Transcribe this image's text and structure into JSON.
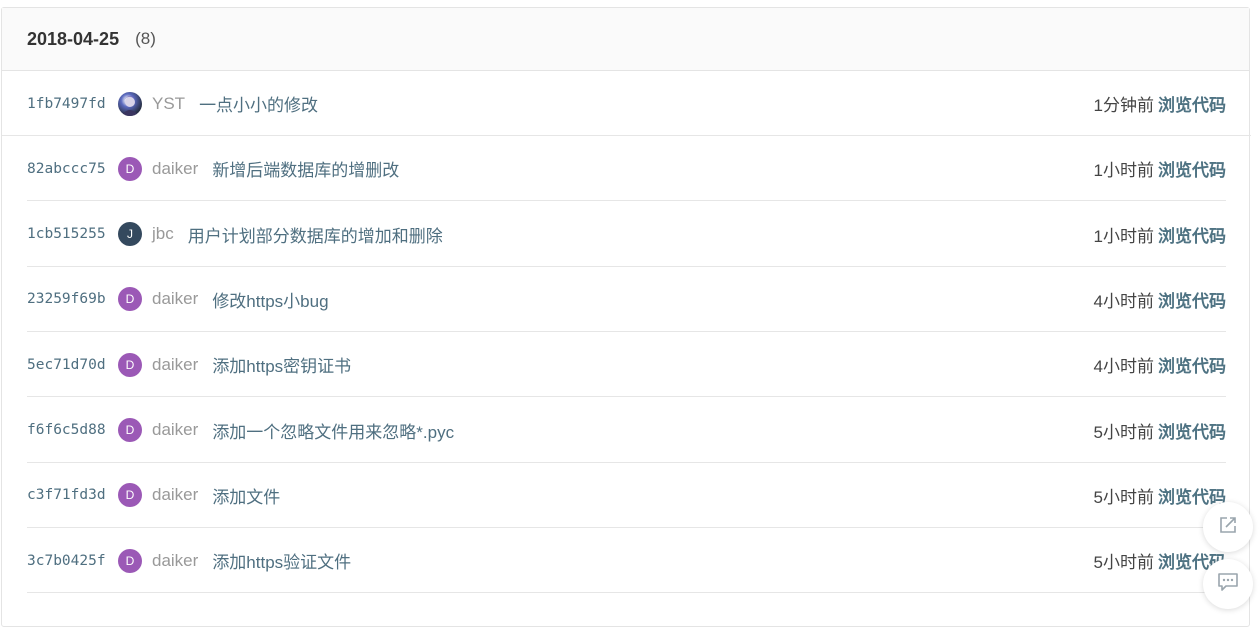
{
  "group": {
    "date": "2018-04-25",
    "count": "(8)"
  },
  "browse_label": "浏览代码",
  "commits": [
    {
      "sha": "1fb7497fd",
      "avatar": "",
      "avatar_type": "photo",
      "avatar_color": "#4a3f7a",
      "author": "YST",
      "message": "一点小小的修改",
      "time": "1分钟前"
    },
    {
      "sha": "82abccc75",
      "avatar": "D",
      "avatar_type": "initial",
      "avatar_color": "#9b59b6",
      "author": "daiker",
      "message": "新增后端数据库的增删改",
      "time": "1小时前"
    },
    {
      "sha": "1cb515255",
      "avatar": "J",
      "avatar_type": "initial",
      "avatar_color": "#34495e",
      "author": "jbc",
      "message": "用户计划部分数据库的增加和删除",
      "time": "1小时前"
    },
    {
      "sha": "23259f69b",
      "avatar": "D",
      "avatar_type": "initial",
      "avatar_color": "#9b59b6",
      "author": "daiker",
      "message": "修改https小bug",
      "time": "4小时前"
    },
    {
      "sha": "5ec71d70d",
      "avatar": "D",
      "avatar_type": "initial",
      "avatar_color": "#9b59b6",
      "author": "daiker",
      "message": "添加https密钥证书",
      "time": "4小时前"
    },
    {
      "sha": "f6f6c5d88",
      "avatar": "D",
      "avatar_type": "initial",
      "avatar_color": "#9b59b6",
      "author": "daiker",
      "message": "添加一个忽略文件用来忽略*.pyc",
      "time": "5小时前"
    },
    {
      "sha": "c3f71fd3d",
      "avatar": "D",
      "avatar_type": "initial",
      "avatar_color": "#9b59b6",
      "author": "daiker",
      "message": "添加文件",
      "time": "5小时前"
    },
    {
      "sha": "3c7b0425f",
      "avatar": "D",
      "avatar_type": "initial",
      "avatar_color": "#9b59b6",
      "author": "daiker",
      "message": "添加https验证文件",
      "time": "5小时前"
    }
  ],
  "floating_actions": [
    {
      "icon": "share-icon"
    },
    {
      "icon": "comment-icon"
    }
  ]
}
